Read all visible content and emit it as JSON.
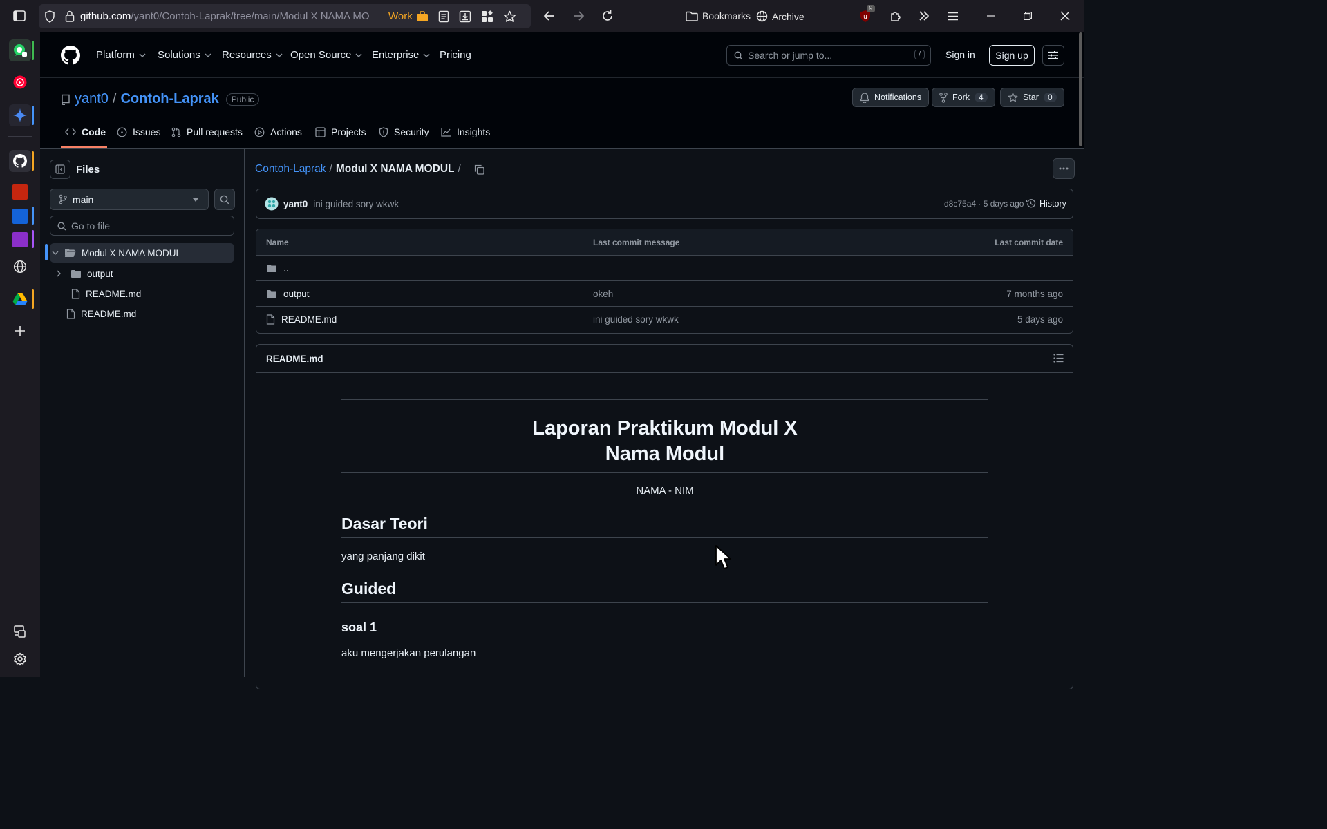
{
  "browser": {
    "url_host": "github.com",
    "url_path": "/yant0/Contoh-Laprak/tree/main/Modul X NAMA MO",
    "work_label": "Work",
    "bookmarks_label": "Bookmarks",
    "archive_label": "Archive",
    "extension_badge": "9"
  },
  "header": {
    "nav": [
      "Platform",
      "Solutions",
      "Resources",
      "Open Source",
      "Enterprise",
      "Pricing"
    ],
    "search_placeholder": "Search or jump to...",
    "search_shortcut": "/",
    "sign_in": "Sign in",
    "sign_up": "Sign up"
  },
  "repo": {
    "owner": "yant0",
    "separator": "/",
    "name": "Contoh-Laprak",
    "visibility": "Public",
    "notifications_label": "Notifications",
    "fork_label": "Fork",
    "fork_count": "4",
    "star_label": "Star",
    "star_count": "0",
    "tabs": [
      "Code",
      "Issues",
      "Pull requests",
      "Actions",
      "Projects",
      "Security",
      "Insights"
    ]
  },
  "file_tree": {
    "title": "Files",
    "branch": "main",
    "goto_placeholder": "Go to file",
    "items": [
      {
        "label": "Modul X NAMA MODUL",
        "type": "folder",
        "expanded": true
      },
      {
        "label": "output",
        "type": "folder"
      },
      {
        "label": "README.md",
        "type": "file"
      },
      {
        "label": "README.md",
        "type": "file"
      }
    ]
  },
  "breadcrumb": {
    "repo": "Contoh-Laprak",
    "sep1": "/",
    "folder": "Modul X NAMA MODUL",
    "sep2": "/"
  },
  "commit": {
    "author": "yant0",
    "message": "ini guided sory wkwk",
    "meta": "d8c75a4 · 5 days ago",
    "history_label": "History"
  },
  "table": {
    "headers": {
      "name": "Name",
      "message": "Last commit message",
      "date": "Last commit date"
    },
    "parent": "..",
    "rows": [
      {
        "name": "output",
        "type": "folder",
        "message": "okeh",
        "date": "7 months ago"
      },
      {
        "name": "README.md",
        "type": "file",
        "message": "ini guided sory wkwk",
        "date": "5 days ago"
      }
    ]
  },
  "readme": {
    "filename": "README.md",
    "title_line1": "Laporan Praktikum Modul X",
    "title_line2": "Nama Modul",
    "subtitle": "NAMA - NIM",
    "h1_teori": "Dasar Teori",
    "p_teori": "yang panjang dikit",
    "h1_guided": "Guided",
    "h3_soal": "soal 1",
    "p_soal": "aku mengerjakan perulangan"
  },
  "colors": {
    "accent_link": "#4493f8",
    "tab_underline": "#f78166",
    "work_color": "#f5a623"
  }
}
